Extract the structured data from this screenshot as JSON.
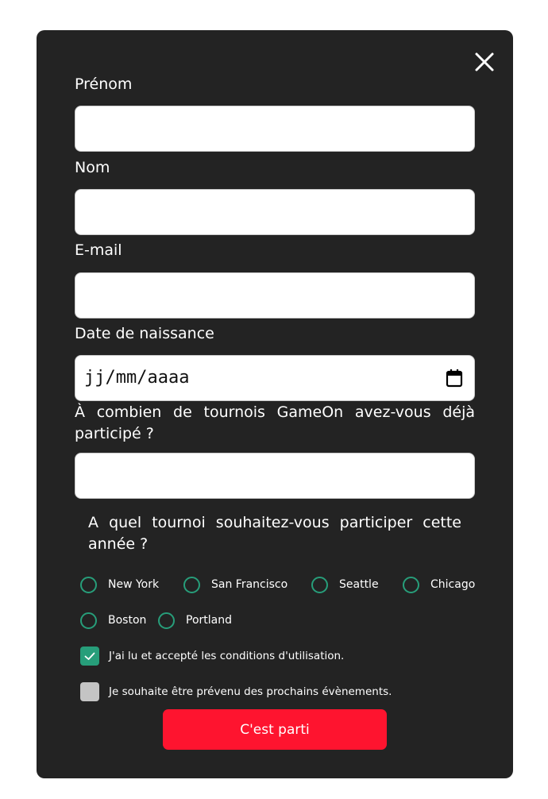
{
  "form": {
    "close_icon": "close-icon",
    "fields": {
      "first_name": {
        "label": "Prénom",
        "value": ""
      },
      "last_name": {
        "label": "Nom",
        "value": ""
      },
      "email": {
        "label": "E-mail",
        "value": ""
      },
      "birthdate": {
        "label": "Date de naissance",
        "placeholder": "jj/mm/aaaa",
        "icon": "calendar-icon"
      },
      "tournaments": {
        "label": "À combien de tournois GameOn avez-vous déjà participé ?",
        "value": ""
      }
    },
    "location_question": "A quel tournoi souhaitez-vous participer cette année ?",
    "locations": [
      {
        "label": "New York",
        "selected": false
      },
      {
        "label": "San Francisco",
        "selected": false
      },
      {
        "label": "Seattle",
        "selected": false
      },
      {
        "label": "Chicago",
        "selected": false
      },
      {
        "label": "Boston",
        "selected": false
      },
      {
        "label": "Portland",
        "selected": false
      }
    ],
    "checkboxes": [
      {
        "label": "J'ai lu et accepté les conditions d'utilisation.",
        "checked": true
      },
      {
        "label": "Je souhaite être prévenu des prochains évènements.",
        "checked": false
      }
    ],
    "submit_label": "C'est parti"
  },
  "colors": {
    "modal_bg": "#232323",
    "accent_green": "#279e7a",
    "submit_red": "#fe142f",
    "checkbox_unchecked": "#c4c4c4"
  }
}
